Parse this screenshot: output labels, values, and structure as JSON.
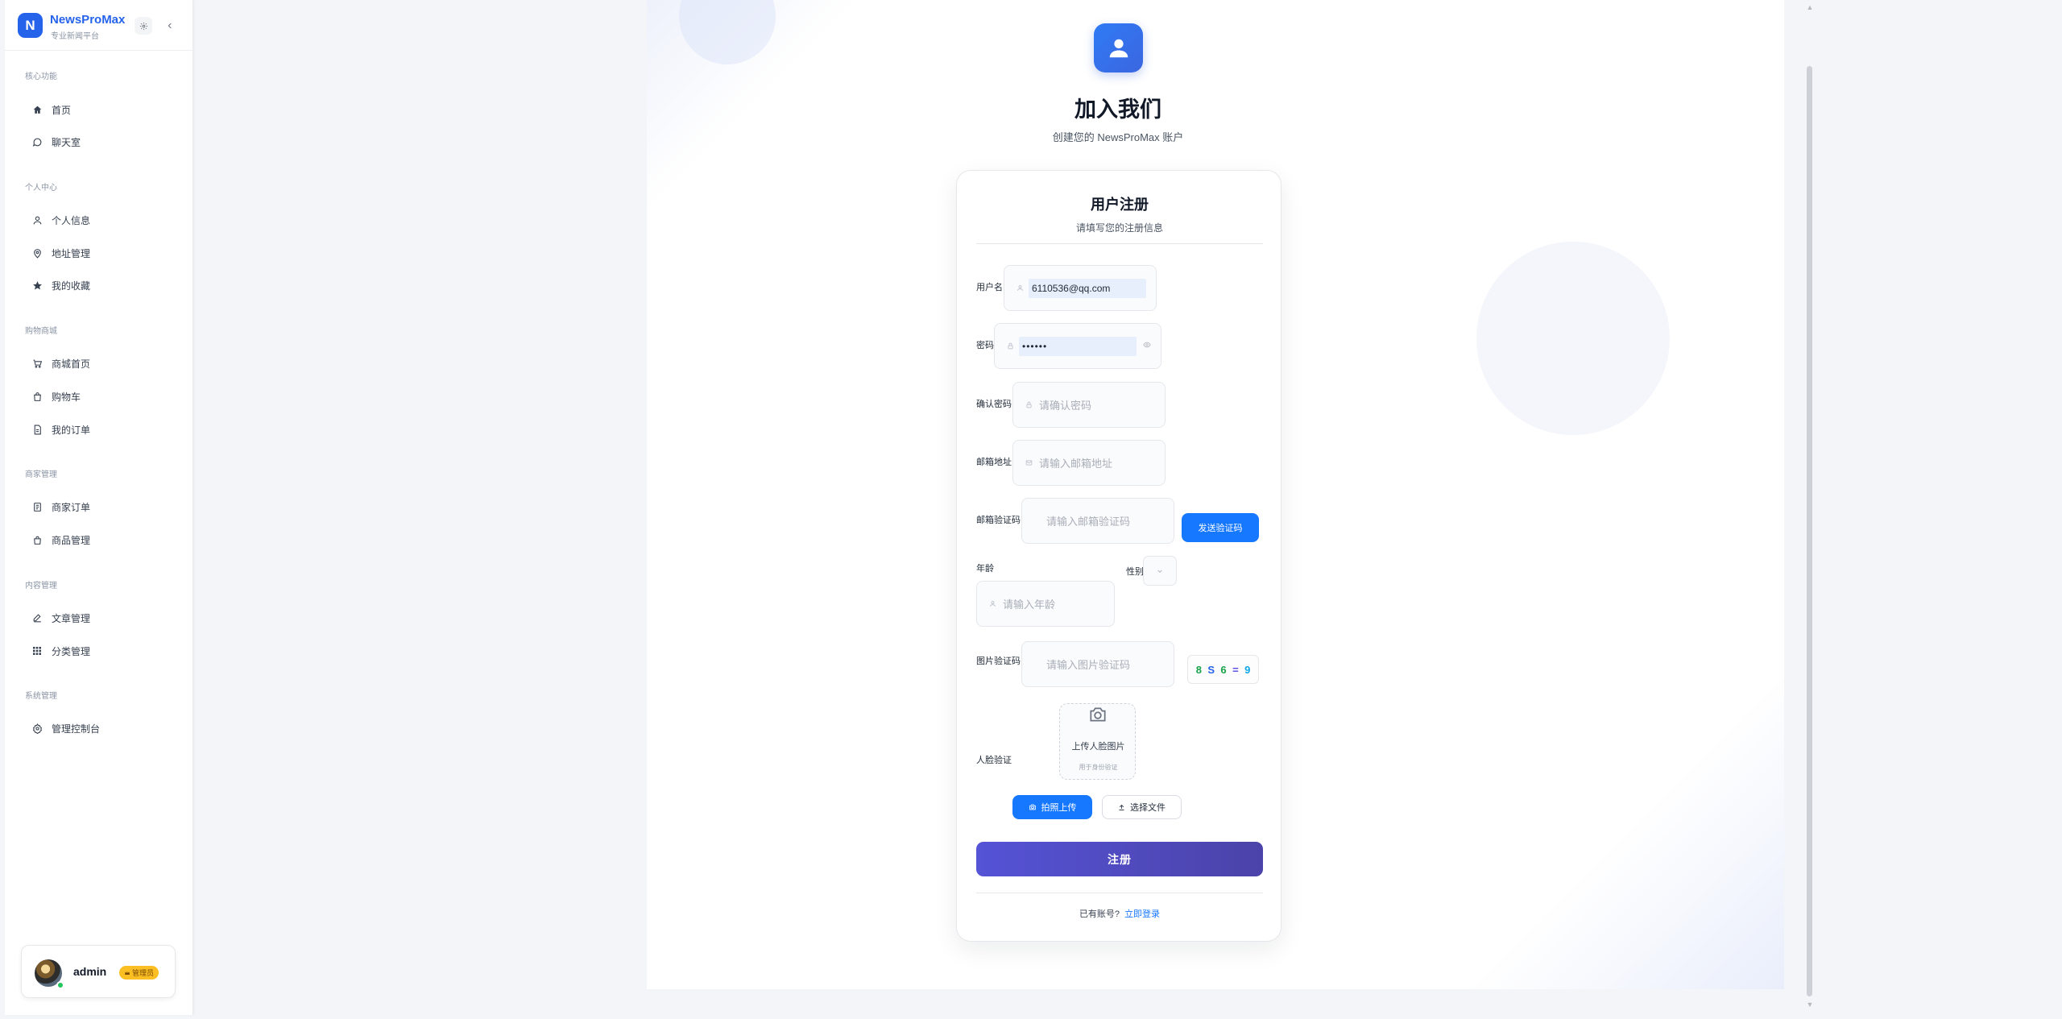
{
  "brand": {
    "logo_letter": "N",
    "name": "NewsProMax",
    "subtitle": "专业新闻平台"
  },
  "sidebar": {
    "sections": [
      {
        "title": "核心功能",
        "items": [
          {
            "label": "首页",
            "icon": "home-icon"
          },
          {
            "label": "聊天室",
            "icon": "chat-icon"
          }
        ]
      },
      {
        "title": "个人中心",
        "items": [
          {
            "label": "个人信息",
            "icon": "user-icon"
          },
          {
            "label": "地址管理",
            "icon": "location-icon"
          },
          {
            "label": "我的收藏",
            "icon": "star-icon"
          }
        ]
      },
      {
        "title": "购物商城",
        "items": [
          {
            "label": "商城首页",
            "icon": "cart-icon"
          },
          {
            "label": "购物车",
            "icon": "bag-icon"
          },
          {
            "label": "我的订单",
            "icon": "order-icon"
          }
        ]
      },
      {
        "title": "商家管理",
        "items": [
          {
            "label": "商家订单",
            "icon": "receipt-icon"
          },
          {
            "label": "商品管理",
            "icon": "product-icon"
          }
        ]
      },
      {
        "title": "内容管理",
        "items": [
          {
            "label": "文章管理",
            "icon": "edit-icon"
          },
          {
            "label": "分类管理",
            "icon": "grid-icon"
          }
        ]
      },
      {
        "title": "系统管理",
        "items": [
          {
            "label": "管理控制台",
            "icon": "settings-icon"
          }
        ]
      }
    ]
  },
  "user": {
    "name": "admin",
    "role": "管理员",
    "role_icon": "crown-icon",
    "status_color": "#22c55e"
  },
  "hero": {
    "title": "加入我们",
    "subtitle": "创建您的 NewsProMax 账户"
  },
  "form": {
    "title": "用户注册",
    "subtitle": "请填写您的注册信息",
    "username": {
      "label": "用户名",
      "value": "6110536@qq.com"
    },
    "password": {
      "label": "密码",
      "value": "••••••"
    },
    "confirm_password": {
      "label": "确认密码",
      "placeholder": "请确认密码"
    },
    "email": {
      "label": "邮箱地址",
      "placeholder": "请输入邮箱地址"
    },
    "email_code": {
      "label": "邮箱验证码",
      "placeholder": "请输入邮箱验证码",
      "button": "发送验证码"
    },
    "age": {
      "label": "年龄",
      "placeholder": "请输入年龄"
    },
    "gender": {
      "label": "性别",
      "value": ""
    },
    "image_code": {
      "label": "图片验证码",
      "placeholder": "请输入图片验证码",
      "captcha_chars": [
        "8",
        "S",
        "6",
        "=",
        "9"
      ],
      "captcha_colors": [
        "#16a34a",
        "#2563eb",
        "#16a34a",
        "#4f46e5",
        "#0ea5e9"
      ]
    },
    "face": {
      "label": "人脸验证",
      "upload_title": "上传人脸图片",
      "upload_hint": "用于身份验证",
      "camera_button": "拍照上传",
      "file_button": "选择文件"
    },
    "submit": "注册",
    "login_prompt": "已有账号?",
    "login_link": "立即登录"
  },
  "colors": {
    "brand": "#2563eb",
    "primary_button": "#1677ff",
    "submit_gradient_start": "#5553d6",
    "submit_gradient_end": "#4b43a9",
    "badge": "#fbbf24"
  }
}
